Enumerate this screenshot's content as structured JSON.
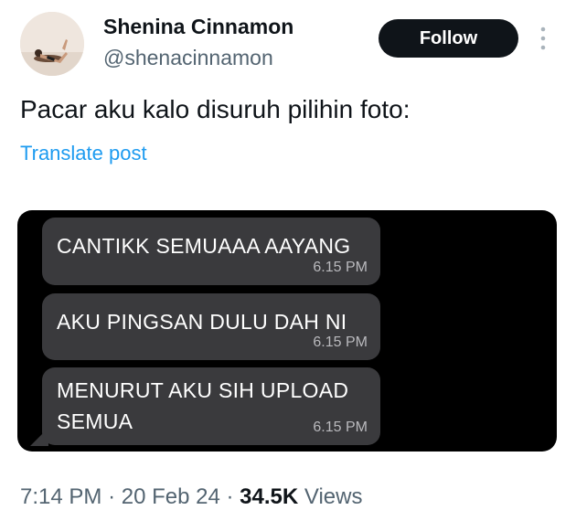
{
  "author": {
    "name": "Shenina Cinnamon",
    "handle": "@shenacinnamon"
  },
  "follow_label": "Follow",
  "tweet_text": "Pacar aku kalo disuruh pilihin foto:",
  "translate_label": "Translate post",
  "chat": {
    "messages": [
      {
        "text": "CANTIKK SEMUAAA AAYANG",
        "time": "6.15 PM"
      },
      {
        "text": "AKU PINGSAN DULU DAH NI",
        "time": "6.15 PM"
      },
      {
        "line1": "MENURUT AKU SIH UPLOAD",
        "line2": "SEMUA",
        "time": "6.15 PM"
      }
    ]
  },
  "meta": {
    "time": "7:14 PM",
    "separator": "·",
    "date": "20 Feb 24",
    "views_count": "34.5K",
    "views_label": "Views"
  },
  "colors": {
    "follow_bg": "#0f1419",
    "link": "#1d9bf0",
    "bubble": "#3a3a3d"
  }
}
